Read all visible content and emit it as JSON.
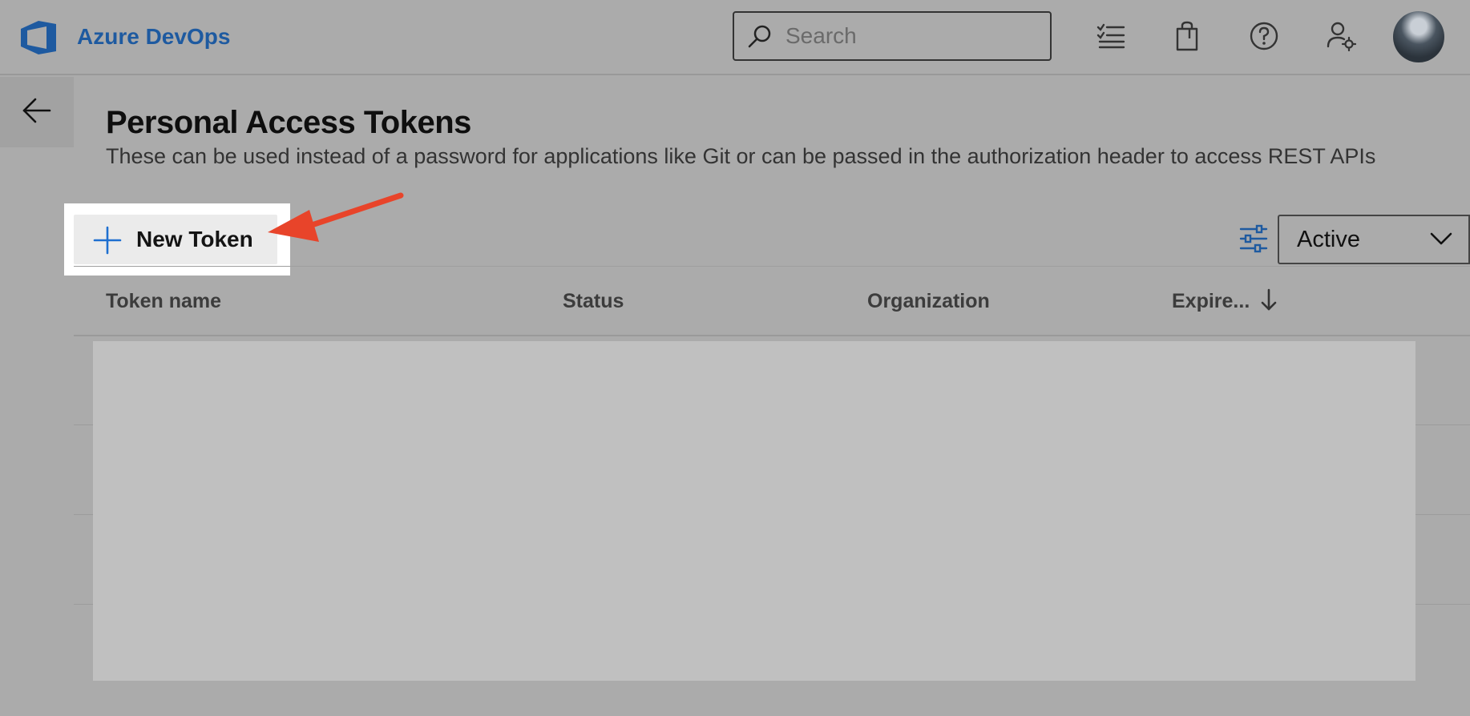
{
  "header": {
    "app_title": "Azure DevOps",
    "search": {
      "placeholder": "Search"
    },
    "icons": [
      "work-items-icon",
      "marketplace-bag-icon",
      "help-icon",
      "user-settings-icon"
    ],
    "brand_color": "#1e5aa0"
  },
  "page": {
    "title": "Personal Access Tokens",
    "description": "These can be used instead of a password for applications like Git or can be passed in the authorization header to access REST APIs"
  },
  "toolbar": {
    "new_token_label": "New Token",
    "filter_value": "Active"
  },
  "table": {
    "columns": [
      "Token name",
      "Status",
      "Organization",
      "Expire..."
    ],
    "sort_icon": "arrow-down-icon"
  },
  "annotation": {
    "arrow_color": "#e8442a"
  }
}
